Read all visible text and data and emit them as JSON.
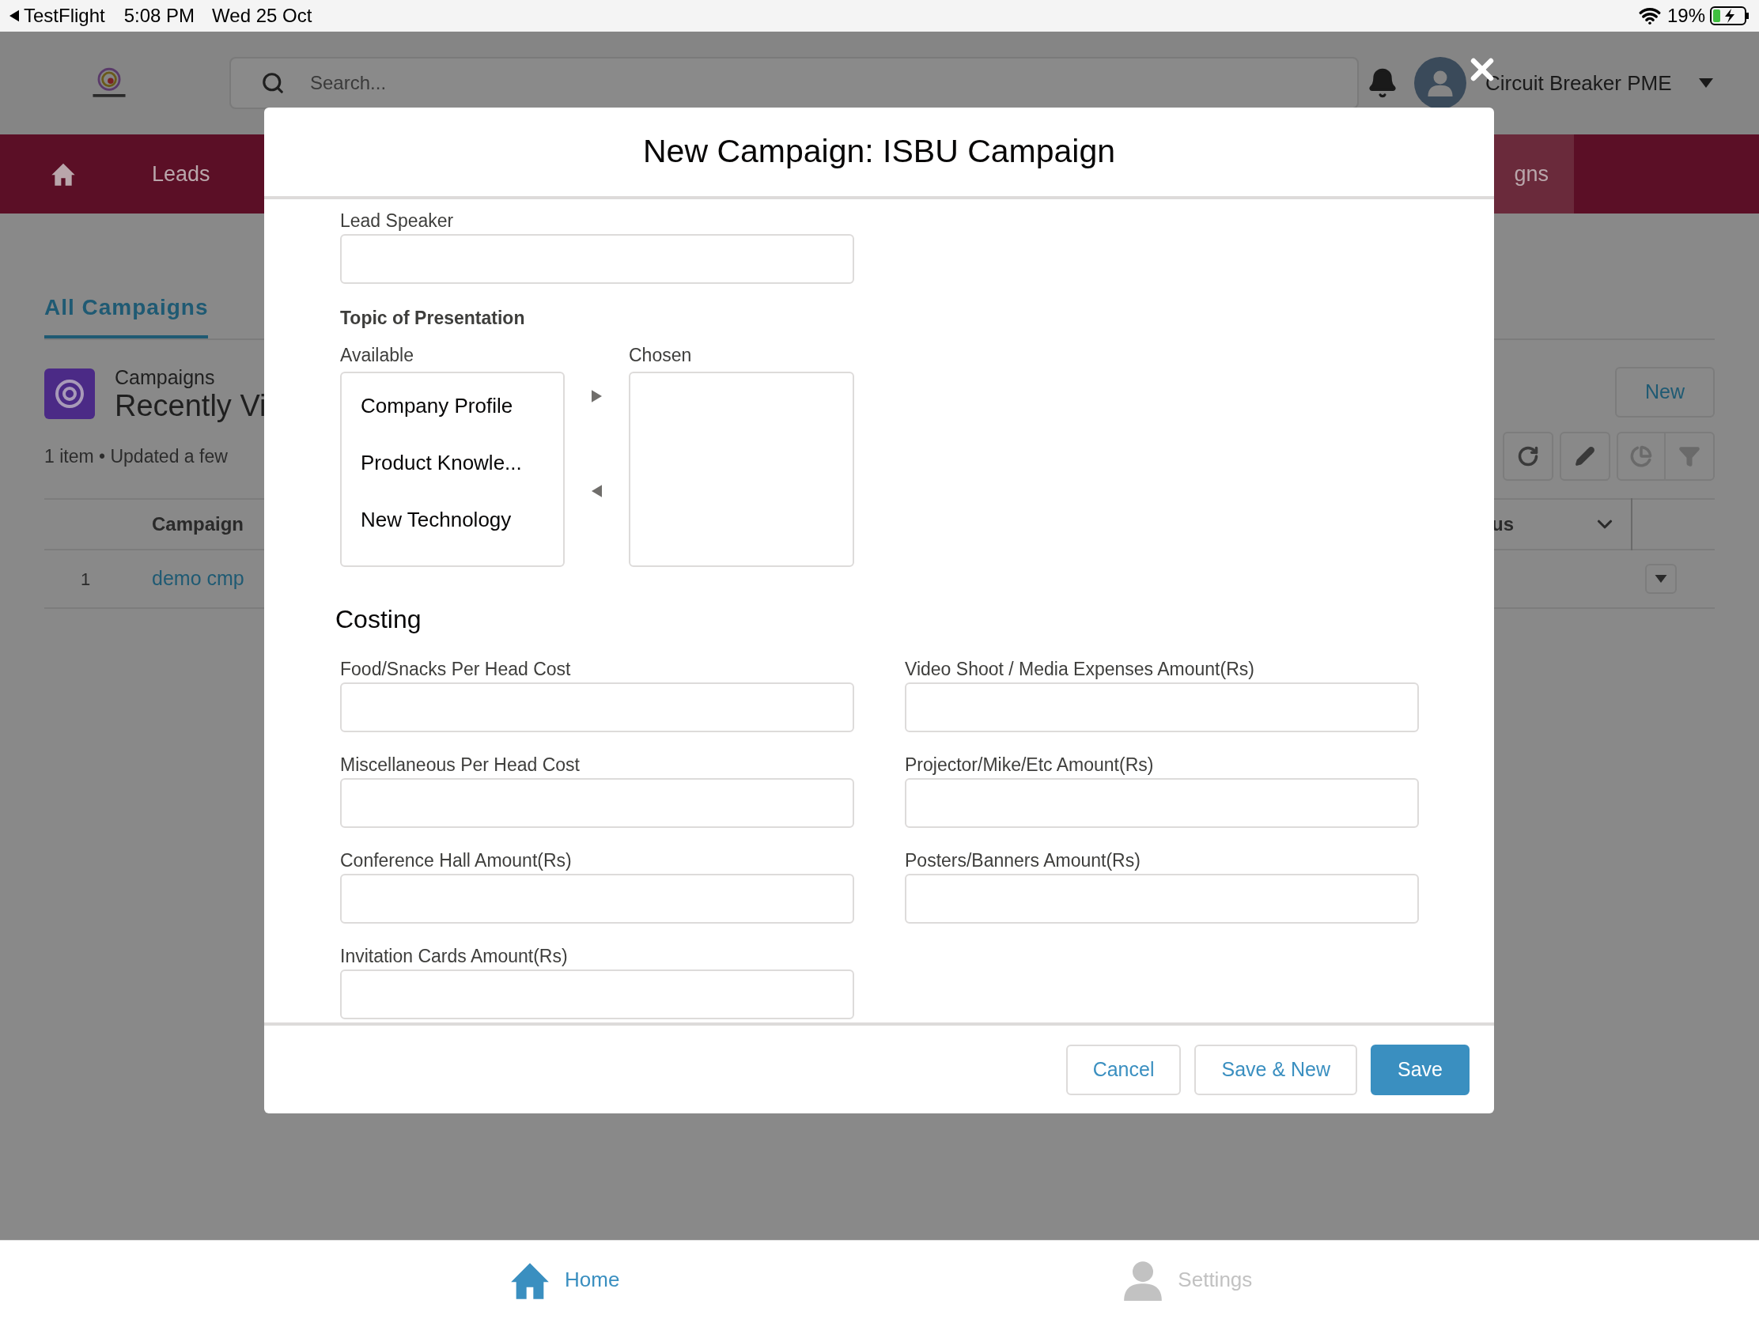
{
  "status_bar": {
    "back_app": "TestFlight",
    "time": "5:08 PM",
    "date": "Wed 25 Oct",
    "battery": "19%"
  },
  "header": {
    "search_placeholder": "Search...",
    "user_name": "Circuit Breaker PME"
  },
  "nav": {
    "items": [
      {
        "label": "Leads",
        "selected": false
      },
      {
        "label": "gns",
        "selected": true
      }
    ]
  },
  "list_view": {
    "tab": {
      "label": "All Campaigns",
      "selected": true
    },
    "object_name": "Campaigns",
    "view_title": "Recently Vi",
    "meta": "1 item • Updated a few",
    "new_button": "New",
    "columns": [
      "Campaign",
      "us"
    ],
    "rows": [
      {
        "number": "1",
        "name": "demo cmp"
      }
    ]
  },
  "modal": {
    "title": "New Campaign: ISBU Campaign",
    "lead_speaker": {
      "label": "Lead Speaker"
    },
    "topic": {
      "label": "Topic of Presentation",
      "available_label": "Available",
      "chosen_label": "Chosen",
      "available": [
        "Company Profile",
        "Product Knowle...",
        "New Technology"
      ]
    },
    "costing": {
      "heading": "Costing",
      "fields": [
        {
          "label": "Food/Snacks Per Head Cost"
        },
        {
          "label": "Video Shoot / Media Expenses Amount(Rs)"
        },
        {
          "label": "Miscellaneous Per Head Cost"
        },
        {
          "label": "Projector/Mike/Etc Amount(Rs)"
        },
        {
          "label": "Conference Hall Amount(Rs)"
        },
        {
          "label": "Posters/Banners Amount(Rs)"
        },
        {
          "label": "Invitation Cards Amount(Rs)"
        }
      ]
    },
    "buttons": [
      {
        "label": "Cancel",
        "kind": "neutral"
      },
      {
        "label": "Save & New",
        "kind": "neutral"
      },
      {
        "label": "Save",
        "kind": "brand"
      }
    ]
  },
  "tab_bar": [
    {
      "label": "Home",
      "selected": true,
      "kind": "home"
    },
    {
      "label": "Settings",
      "selected": false,
      "kind": "person"
    }
  ]
}
